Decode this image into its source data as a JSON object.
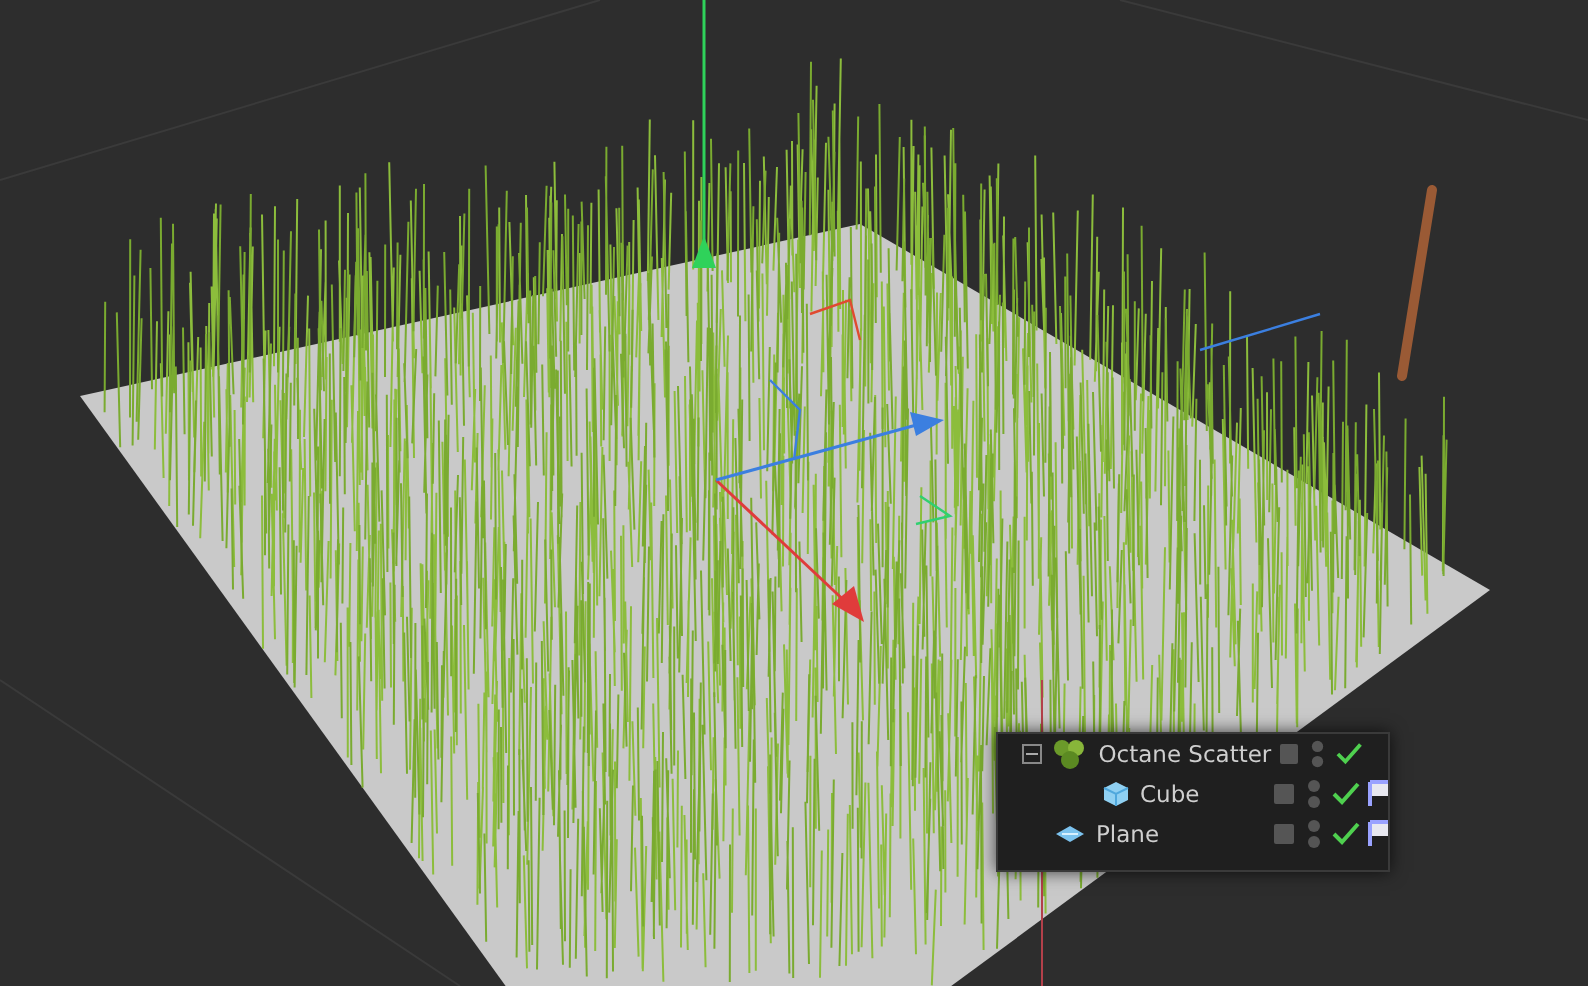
{
  "object_manager": {
    "objects": [
      {
        "name": "Octane Scatter",
        "kind": "scatter",
        "expanded": true,
        "enabled": true,
        "children": [
          {
            "name": "Cube",
            "kind": "cube",
            "enabled": true,
            "tag": true
          }
        ]
      },
      {
        "name": "Plane",
        "kind": "plane",
        "enabled": true,
        "tag": true
      }
    ]
  }
}
